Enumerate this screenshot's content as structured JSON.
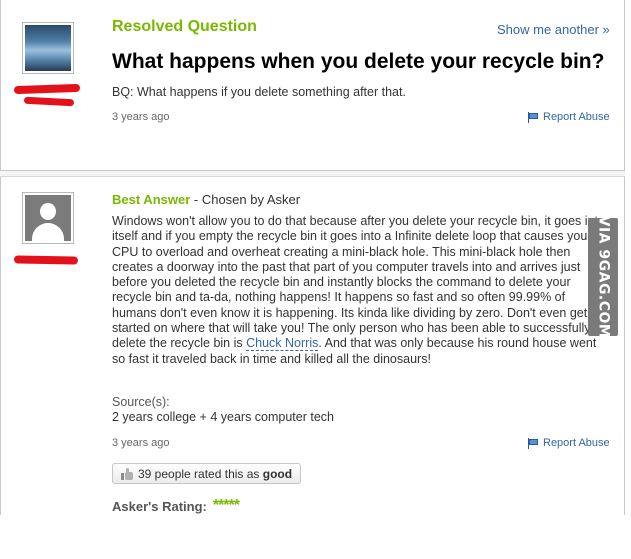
{
  "question": {
    "status": "Resolved Question",
    "show_another": "Show me another »",
    "title": "What happens when you delete your recycle bin?",
    "details": "BQ: What happens if you delete something after that.",
    "time": "3 years ago",
    "report": "Report Abuse"
  },
  "answer": {
    "best_label": "Best Answer",
    "chosen_by": " - Chosen by Asker",
    "text_before_link": "Windows won't allow you to do that because after you delete your recycle bin, it goes into itself and if you empty the recycle bin it goes into a Infinite delete loop that causes your CPU to overload and overheat creating a mini-black hole. This mini-black hole then creates a doorway into the past that part of you computer travels into and arrives just before you deleted the recycle bin and instantly blocks the command to delete your recycle bin and ta-da, nothing happens! It happens so fast and so often 99.99% of humans don't even know it is happening. Its kinda like dividing by zero. Don't even get me started on where that will take you! The only person who has been able to successfully delete the recycle bin is ",
    "link_text": "Chuck Norris",
    "text_after_link": ". And that was only because his round house went so fast it traveled back in time and killed all the dinosaurs!",
    "sources_label": "Source(s):",
    "sources": "2 years college + 4 years computer tech",
    "time": "3 years ago",
    "report": "Report Abuse",
    "rated_prefix": "39 people rated this as ",
    "rated_value": "good",
    "asker_rating_label": "Asker's Rating:",
    "asker_rating_stars": "*****",
    "asker_rating_value": 5
  },
  "watermark": "VIA 9GAG.COM",
  "colors": {
    "accent_green": "#7ab800",
    "link_blue": "#3366aa",
    "redaction_red": "#e3121a"
  },
  "icons": [
    "avatar-photo-icon",
    "default-avatar-icon",
    "flag-icon",
    "thumbs-up-icon"
  ]
}
